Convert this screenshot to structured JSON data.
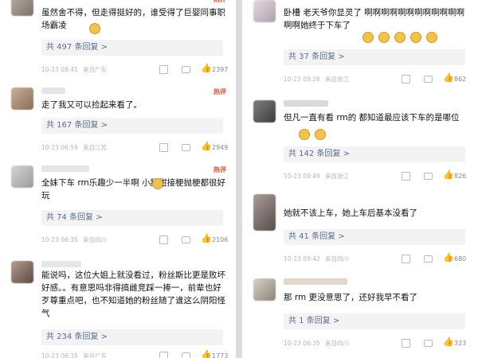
{
  "left_column": [
    {
      "text": "虽然舍不得，但走得挺好的，谁受得了巨婴同事职场霸凌",
      "reply": "共 497 条回复 >",
      "time": "10-23 08:41",
      "location": "来自广东",
      "likes": "2397"
    },
    {
      "text": "走了我又可以捡起来看了。",
      "reply": "共 167 条回复 >",
      "time": "10-23 06:59",
      "location": "来自江苏",
      "likes": "2949"
    },
    {
      "text": "全妹下车 rm乐趣少一半啊 小甜甜接梗抛梗都很好玩",
      "reply": "共 74 条回复 >",
      "time": "10-23 06:35",
      "location": "来自四川",
      "likes": "2106",
      "badge": "热评"
    },
    {
      "text": "能说吗，这位大姐上就没看过，粉丝斯比更是败坏好感。。有意思吗非得搞雌竞踩一捧一，前辈也好歹尊重点吧，也不知道她的粉丝随了谁这么阴阳怪气",
      "reply": "共 234 条回复 >",
      "time": "10-23 06:35",
      "location": "来自广东",
      "likes": "1773"
    }
  ],
  "right_column": [
    {
      "text": "卧槽 老天爷你显灵了 啊啊啊啊啊啊啊啊啊啊啊啊啊啊她终于下车了",
      "reply": "共 37 条回复 >",
      "time": "10-23 09:26",
      "location": "来自浙江",
      "likes": "862"
    },
    {
      "text": "但凡一直有看 rm的 都知道最应该下车的是哪位",
      "reply": "共 142 条回复 >",
      "time": "10-23 09:49",
      "location": "来自浙江",
      "likes": "826"
    },
    {
      "text": "她就不该上车，她上车后基本没看了",
      "reply": "共 41 条回复 >",
      "time": "10-23 09:42",
      "location": "来自四川",
      "likes": "680"
    },
    {
      "text": "那 rm 更没意思了，还好我早不看了",
      "reply": "共 1 条回复 >",
      "time": "10-23 06:35",
      "location": "来自四川",
      "likes": "323"
    }
  ],
  "badge_text": "热评"
}
